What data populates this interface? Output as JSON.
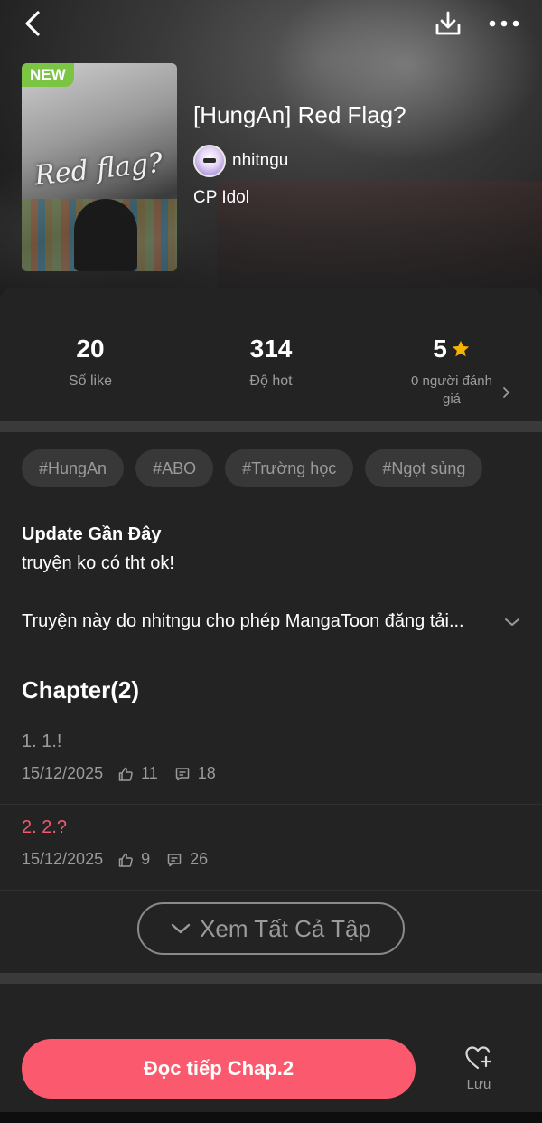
{
  "book": {
    "badge": "NEW",
    "cover_text": "Red flag?",
    "title": "[HungAn] Red Flag?",
    "author": "nhitngu",
    "category": "CP Idol"
  },
  "stats": {
    "likes_value": "20",
    "likes_label": "Số like",
    "hot_value": "314",
    "hot_label": "Độ hot",
    "rating_value": "5",
    "rating_label": "0 người đánh giá"
  },
  "tags": [
    "#HungAn",
    "#ABO",
    "#Trường học",
    "#Ngọt sủng"
  ],
  "update": {
    "heading": "Update Gần Đây",
    "text": "truyện ko có tht ok!"
  },
  "description": "Truyện này do nhitngu cho phép MangaToon đăng tải...",
  "chapters": {
    "heading": "Chapter(2)",
    "items": [
      {
        "title": "1. 1.!",
        "date": "15/12/2025",
        "likes": "11",
        "comments": "18",
        "color": "#9b9b9b"
      },
      {
        "title": "2. 2.?",
        "date": "15/12/2025",
        "likes": "9",
        "comments": "26",
        "color": "#f05a72"
      }
    ],
    "view_all": "Xem Tất Cả Tập"
  },
  "bottom": {
    "read_button": "Đọc tiếp Chap.2",
    "save_label": "Lưu"
  },
  "colors": {
    "accent": "#fb5a6e",
    "new_badge": "#7cc444",
    "star": "#f6b400",
    "background": "#232323"
  },
  "icons": {
    "back": "chevron-left-icon",
    "download": "download-icon",
    "more": "more-dots-icon",
    "star": "star-icon",
    "like": "thumbs-up-icon",
    "comment": "comment-icon",
    "save": "heart-plus-icon"
  }
}
